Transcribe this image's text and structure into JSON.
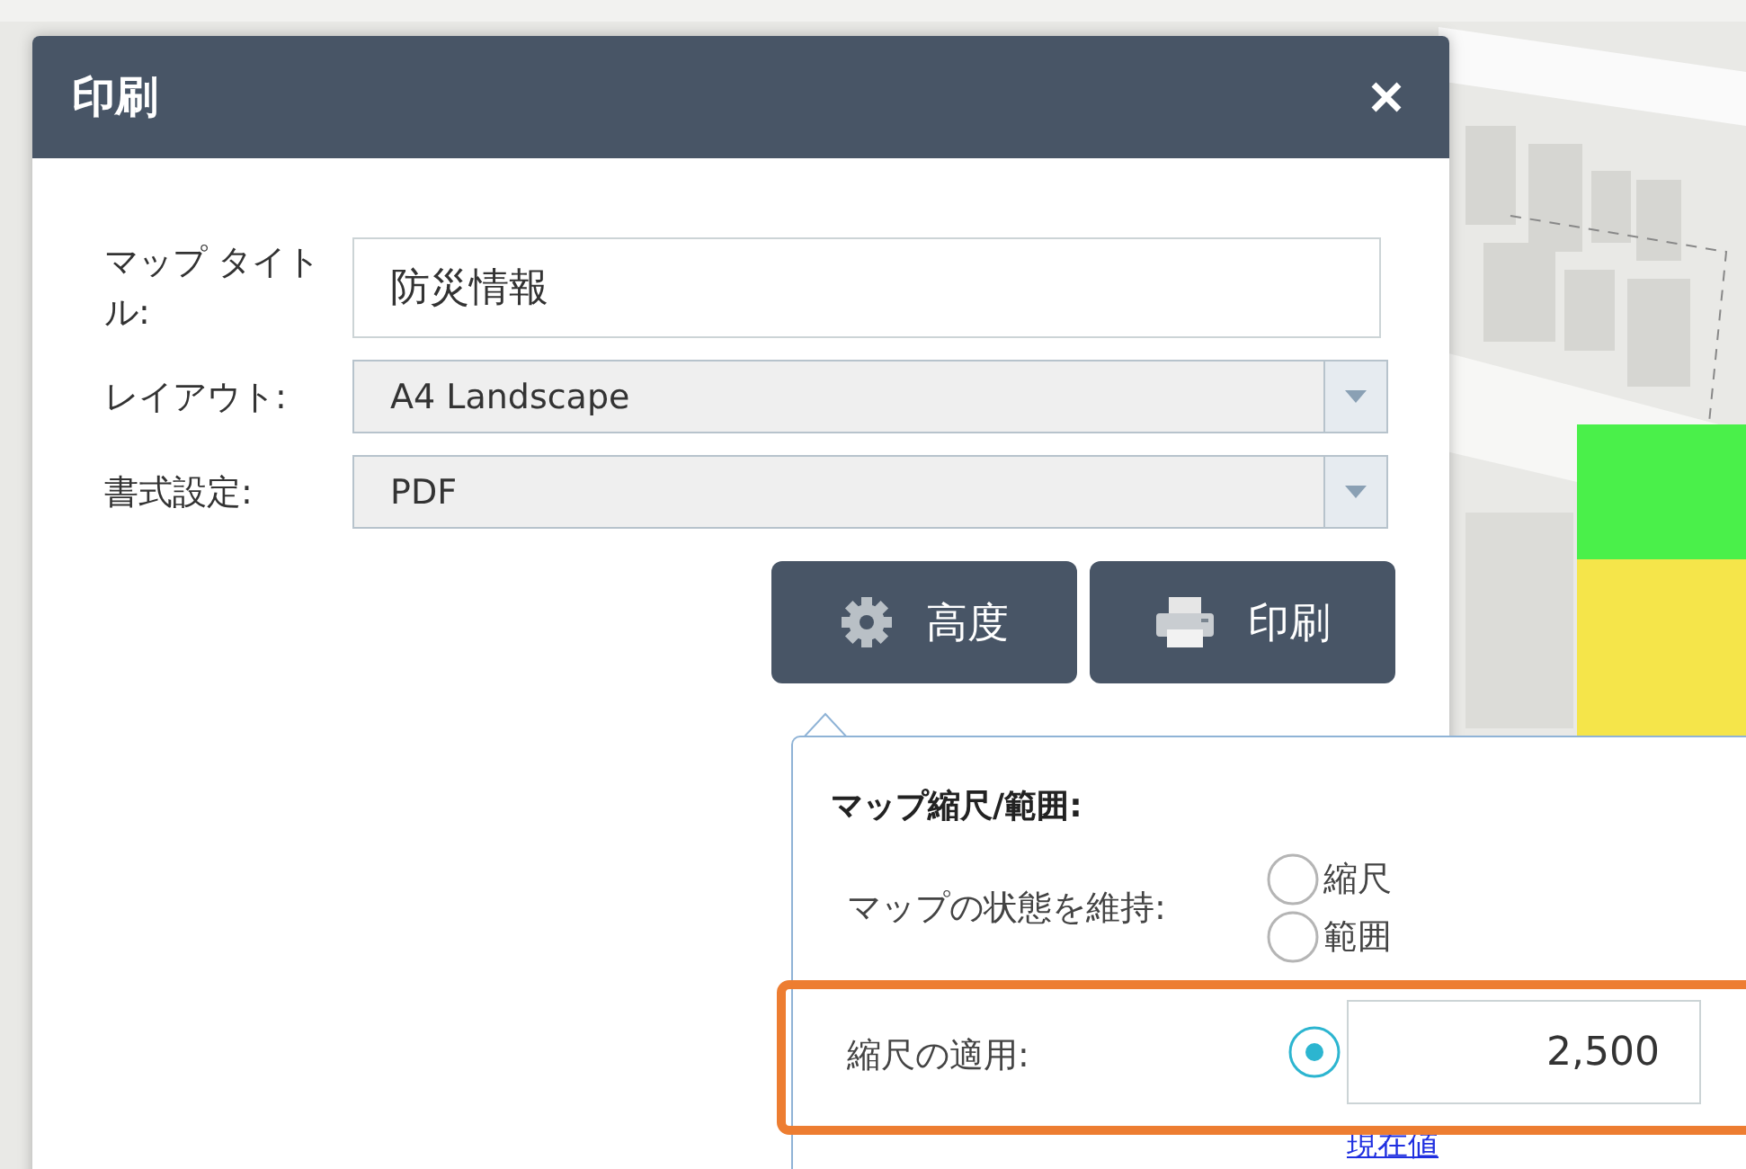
{
  "dialog": {
    "title": "印刷",
    "fields": [
      {
        "kind": "text",
        "label": "マップ タイトル:",
        "value": "防災情報"
      },
      {
        "kind": "select",
        "label": "レイアウト:",
        "value": "A4 Landscape"
      },
      {
        "kind": "select",
        "label": "書式設定:",
        "value": "PDF"
      }
    ],
    "buttons": [
      {
        "kind": "advanced",
        "label": "高度"
      },
      {
        "kind": "print",
        "label": "印刷"
      }
    ]
  },
  "advanced_panel": {
    "heading": "マップ縮尺/範囲:",
    "preserve_label": "マップの状態を維持:",
    "options": [
      {
        "label": "縮尺",
        "selected": false
      },
      {
        "label": "範囲",
        "selected": false
      }
    ],
    "force_scale": {
      "label": "縮尺の適用:",
      "selected": true,
      "value": "2,500",
      "link": "現在値"
    }
  }
}
